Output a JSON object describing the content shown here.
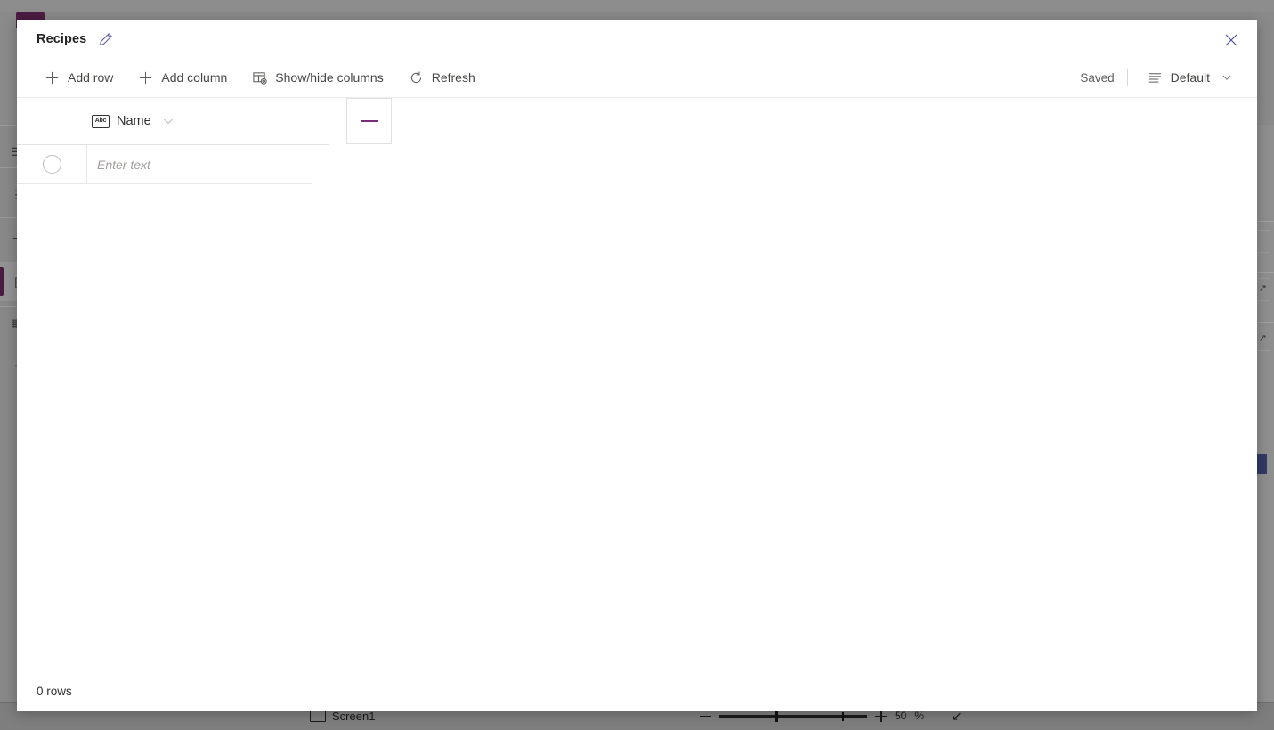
{
  "dialog": {
    "title": "Recipes",
    "edit_icon": "pencil-icon",
    "close_icon": "close-icon",
    "toolbar": {
      "add_row": "Add row",
      "add_column": "Add column",
      "show_hide_columns": "Show/hide columns",
      "refresh": "Refresh",
      "saved_status": "Saved",
      "view_name": "Default",
      "view_icon": "list-view-icon",
      "add_row_icon": "plus-icon",
      "add_column_icon": "plus-icon",
      "show_hide_icon": "columns-settings-icon",
      "refresh_icon": "refresh-icon"
    },
    "grid": {
      "columns": [
        {
          "name": "Name",
          "type_icon": "abc-text-icon",
          "chevron": "chevron-down-icon"
        }
      ],
      "add_column_button_icon": "plus-icon",
      "new_row_placeholder": "Enter text",
      "new_row_value": "",
      "row_selector_icon": "radio-circle-icon",
      "rows": []
    },
    "footer": {
      "row_count": "0 rows"
    },
    "accent_colors": {
      "purple": "#7a2e78",
      "indigo": "#6264a7",
      "close_blue": "#4b52ad",
      "brand_dark_purple": "#4b1c42"
    }
  },
  "background": {
    "screen_label": "Screen1",
    "screen_icon": "screen-icon",
    "zoom_value": "50",
    "zoom_unit": "%",
    "zoom_out_icon": "minus-icon",
    "zoom_in_icon": "plus-icon",
    "fit_icon": "fit-to-screen-icon",
    "sidebar_items": [
      {
        "icon": "tree-view-icon"
      },
      {
        "icon": "insert-icon"
      },
      {
        "icon": "data-icon"
      },
      {
        "icon": "media-icon"
      },
      {
        "icon": "components-icon"
      },
      {
        "icon": "more-icon"
      }
    ]
  }
}
